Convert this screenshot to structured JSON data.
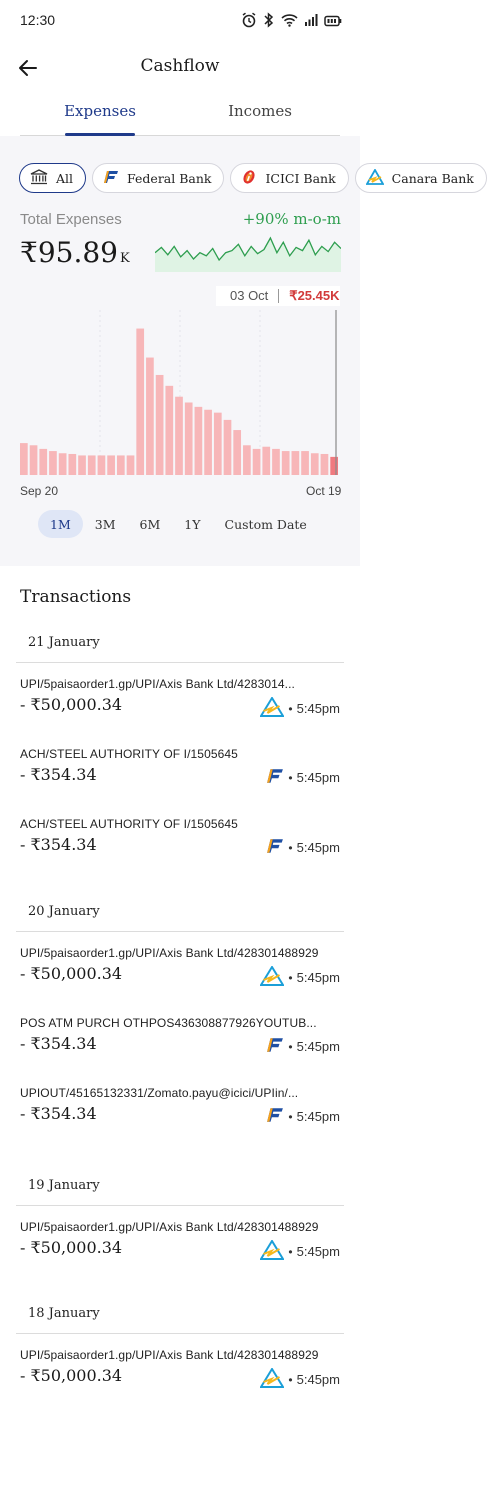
{
  "status_bar": {
    "time": "12:30"
  },
  "header": {
    "title": "Cashflow"
  },
  "tabs": [
    {
      "label": "Expenses",
      "active": true
    },
    {
      "label": "Incomes",
      "active": false
    }
  ],
  "bank_filters": [
    {
      "label": "All",
      "icon": "bank-building-icon",
      "active": true
    },
    {
      "label": "Federal Bank",
      "icon": "federal-bank-logo",
      "active": false
    },
    {
      "label": "ICICI Bank",
      "icon": "icici-bank-logo",
      "active": false
    },
    {
      "label": "Canara Bank",
      "icon": "canara-bank-logo",
      "active": false
    }
  ],
  "summary": {
    "label": "Total Expenses",
    "amount": "₹95.89",
    "unit": "K",
    "change": "+90% m-o-m",
    "change_color": "#2e9e4f"
  },
  "sparkline": [
    12,
    17,
    10,
    18,
    8,
    14,
    6,
    12,
    9,
    16,
    5,
    12,
    14,
    20,
    9,
    18,
    11,
    15,
    26,
    12,
    22,
    9,
    17,
    14,
    24,
    10,
    18,
    13,
    22,
    16
  ],
  "chart_data": {
    "type": "bar",
    "x_start": "Sep 20",
    "x_end": "Oct 19",
    "ylim": [
      0,
      20
    ],
    "values": [
      4.4,
      4.1,
      3.6,
      3.3,
      3.0,
      2.9,
      2.7,
      2.7,
      2.7,
      2.7,
      2.7,
      2.7,
      20.2,
      16.2,
      13.8,
      12.3,
      10.8,
      10.0,
      9.4,
      9.0,
      8.6,
      7.6,
      6.2,
      4.1,
      3.6,
      3.9,
      3.6,
      3.3,
      3.3,
      3.3,
      3.0,
      2.9,
      2.5
    ],
    "highlight": {
      "date": "03 Oct",
      "value": "₹25.45K"
    },
    "bar_color": "#f7b6b8",
    "highlight_color": "#f07a7f"
  },
  "ranges": [
    {
      "label": "1M",
      "active": true
    },
    {
      "label": "3M",
      "active": false
    },
    {
      "label": "6M",
      "active": false
    },
    {
      "label": "1Y",
      "active": false
    },
    {
      "label": "Custom Date",
      "active": false
    }
  ],
  "transactions_title": "Transactions",
  "groups": [
    {
      "date": "21 January",
      "items": [
        {
          "desc": "UPI/5paisaorder1.gp/UPI/Axis Bank Ltd/4283014...",
          "amount": "- ₹50,000.34",
          "bank": "canara",
          "time": "5:45pm"
        },
        {
          "desc": "ACH/STEEL AUTHORITY OF I/1505645",
          "amount": "- ₹354.34",
          "bank": "federal",
          "time": "5:45pm"
        },
        {
          "desc": "ACH/STEEL AUTHORITY OF I/1505645",
          "amount": "- ₹354.34",
          "bank": "federal",
          "time": "5:45pm"
        }
      ]
    },
    {
      "date": "20 January",
      "items": [
        {
          "desc": "UPI/5paisaorder1.gp/UPI/Axis Bank Ltd/428301488929",
          "amount": "- ₹50,000.34",
          "bank": "canara",
          "time": "5:45pm"
        },
        {
          "desc": "POS ATM PURCH   OTHPOS436308877926YOUTUB...",
          "amount": "- ₹354.34",
          "bank": "federal",
          "time": "5:45pm"
        },
        {
          "desc": "UPIOUT/45165132331/Zomato.payu@icici/UPIin/...",
          "amount": "- ₹354.34",
          "bank": "federal",
          "time": "5:45pm"
        }
      ]
    },
    {
      "date": "19 January",
      "items": [
        {
          "desc": "UPI/5paisaorder1.gp/UPI/Axis Bank Ltd/428301488929",
          "amount": "- ₹50,000.34",
          "bank": "canara",
          "time": "5:45pm"
        }
      ]
    },
    {
      "date": "18 January",
      "items": [
        {
          "desc": "UPI/5paisaorder1.gp/UPI/Axis Bank Ltd/428301488929",
          "amount": "- ₹50,000.34",
          "bank": "canara",
          "time": "5:45pm"
        }
      ]
    }
  ]
}
